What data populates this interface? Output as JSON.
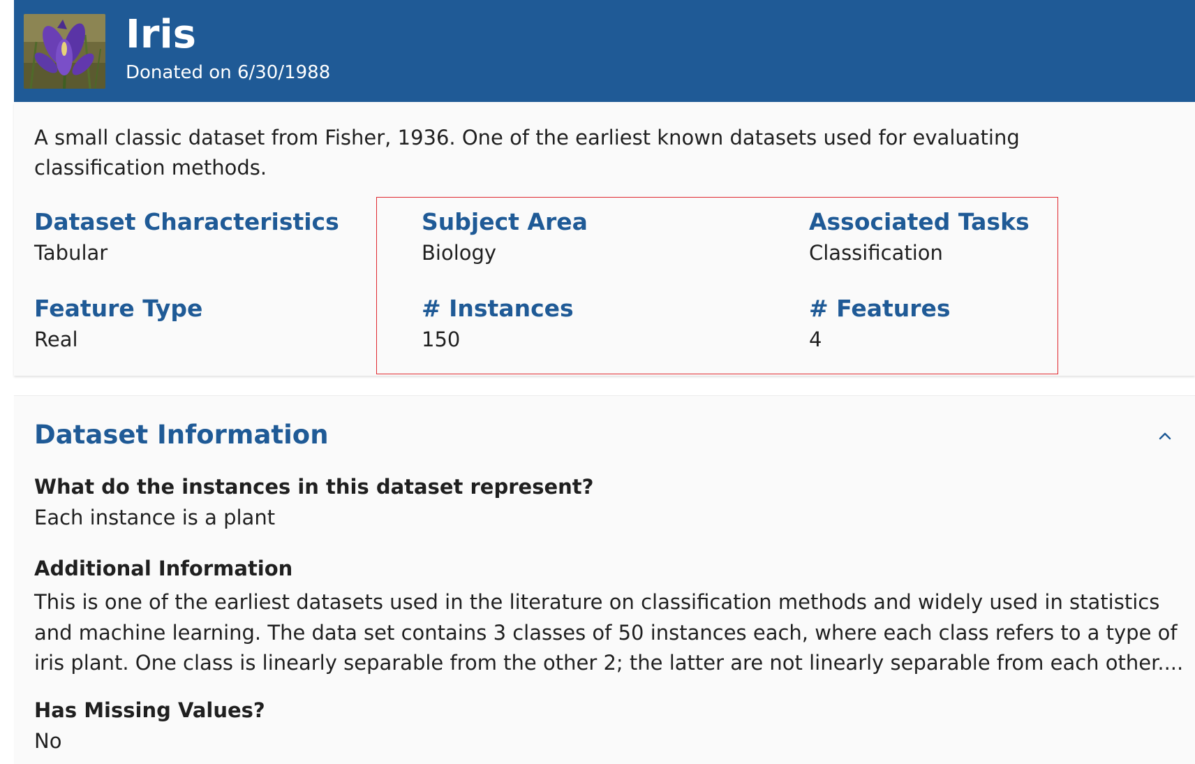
{
  "header": {
    "title": "Iris",
    "subtitle": "Donated on 6/30/1988"
  },
  "summary": {
    "description": "A small classic dataset from Fisher, 1936. One of the earliest known datasets used for evaluating classification methods.",
    "characteristics": [
      {
        "label": "Dataset Characteristics",
        "value": "Tabular"
      },
      {
        "label": "Subject Area",
        "value": "Biology"
      },
      {
        "label": "Associated Tasks",
        "value": "Classification"
      },
      {
        "label": "Feature Type",
        "value": "Real"
      },
      {
        "label": "# Instances",
        "value": "150"
      },
      {
        "label": "# Features",
        "value": "4"
      }
    ]
  },
  "info": {
    "title": "Dataset Information",
    "sections": [
      {
        "question": "What do the instances in this dataset represent?",
        "answer": "Each instance is a plant"
      },
      {
        "question": "Additional Information",
        "answer": "This is one of the earliest datasets used in the literature on classification methods and widely used in statistics and machine learning.  The data set contains 3 classes of 50 instances each, where each class refers to a type of iris plant. One class is linearly separable from the other 2; the latter are not linearly separable from each other...."
      },
      {
        "question": "Has Missing Values?",
        "answer": "No"
      }
    ]
  },
  "colors": {
    "header_bg": "#1f5a96",
    "label_blue": "#1f5a96",
    "highlight_border": "#e0282e"
  },
  "icons": {
    "thumbnail": "iris-flower-image",
    "collapse": "chevron-up-icon"
  }
}
